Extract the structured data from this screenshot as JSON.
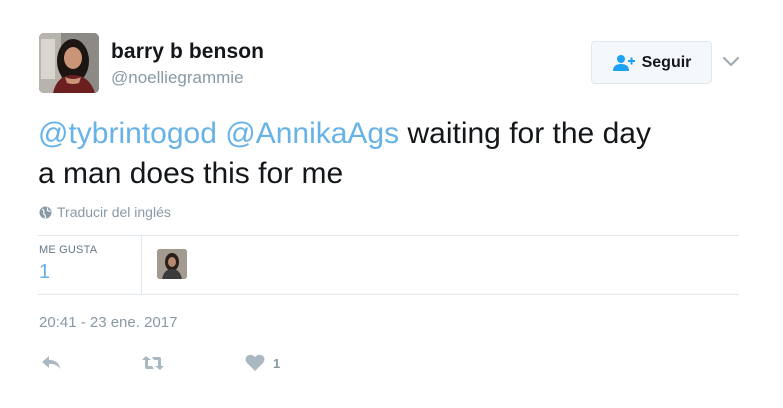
{
  "author": {
    "display_name": "barry b benson",
    "handle": "@noelliegrammie",
    "avatar_icon": "profile-photo"
  },
  "header": {
    "follow_label": "Seguir",
    "follow_icon": "add-user-icon",
    "menu_icon": "chevron-down-icon"
  },
  "tweet": {
    "mention_1": "@tybrintogod",
    "mention_2": "@AnnikaAgs",
    "text_part_1": "waiting for the day",
    "text_part_2": "a man does this for me"
  },
  "translate": {
    "label": "Traducir del inglés",
    "icon": "globe-icon"
  },
  "stats": {
    "likes_label": "ME GUSTA",
    "likes_count": "1"
  },
  "timestamp": "20:41 - 23 ene. 2017",
  "actions": {
    "reply_icon": "reply-icon",
    "retweet_icon": "retweet-icon",
    "like_icon": "heart-icon",
    "like_count": "1"
  },
  "colors": {
    "link": "#67b2e6",
    "muted": "#8899a6",
    "text": "#14171a",
    "border": "#e1e8ed"
  }
}
